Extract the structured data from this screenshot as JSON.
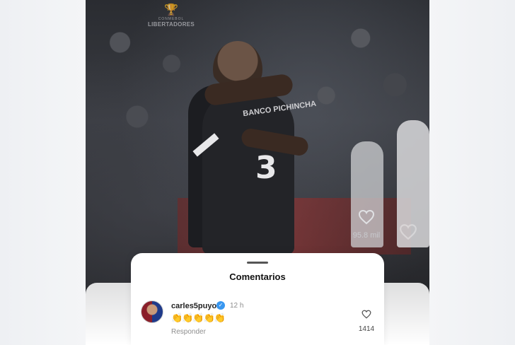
{
  "watermark": {
    "small": "CONMEBOL",
    "big": "LIBERTADORES"
  },
  "jersey": {
    "sponsor": "BANCO PICHINCHA",
    "number": "3"
  },
  "reel": {
    "like_count": "95.8 mil"
  },
  "comments_sheet": {
    "title": "Comentarios",
    "comments": [
      {
        "username": "carles5puyol",
        "verified": true,
        "time": "12 h",
        "text": "👏👏👏👏👏",
        "reply_label": "Responder",
        "likes": "1414"
      }
    ]
  },
  "colors": {
    "verified": "#3897f0",
    "sheet_bg": "#ffffff",
    "muted_text": "#8e8e8e"
  }
}
